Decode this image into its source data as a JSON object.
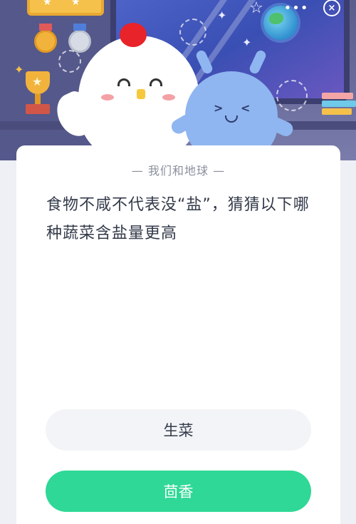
{
  "header": {
    "actions": [
      {
        "icon": "star-outline-icon",
        "glyph": "☆"
      },
      {
        "icon": "more-icon",
        "glyph": "•••"
      },
      {
        "icon": "close-icon",
        "glyph": "×"
      }
    ]
  },
  "quiz": {
    "subtitle": "— 我们和地球 —",
    "question": "食物不咸不代表没“盐”，猜猜以下哪种蔬菜含盐量更高",
    "options": [
      {
        "label": "生菜"
      },
      {
        "label": "茴香"
      }
    ]
  },
  "colors": {
    "accent": "#2fd896",
    "option_bg": "#f3f4f7",
    "hero_bg": "#5a5d8c"
  }
}
